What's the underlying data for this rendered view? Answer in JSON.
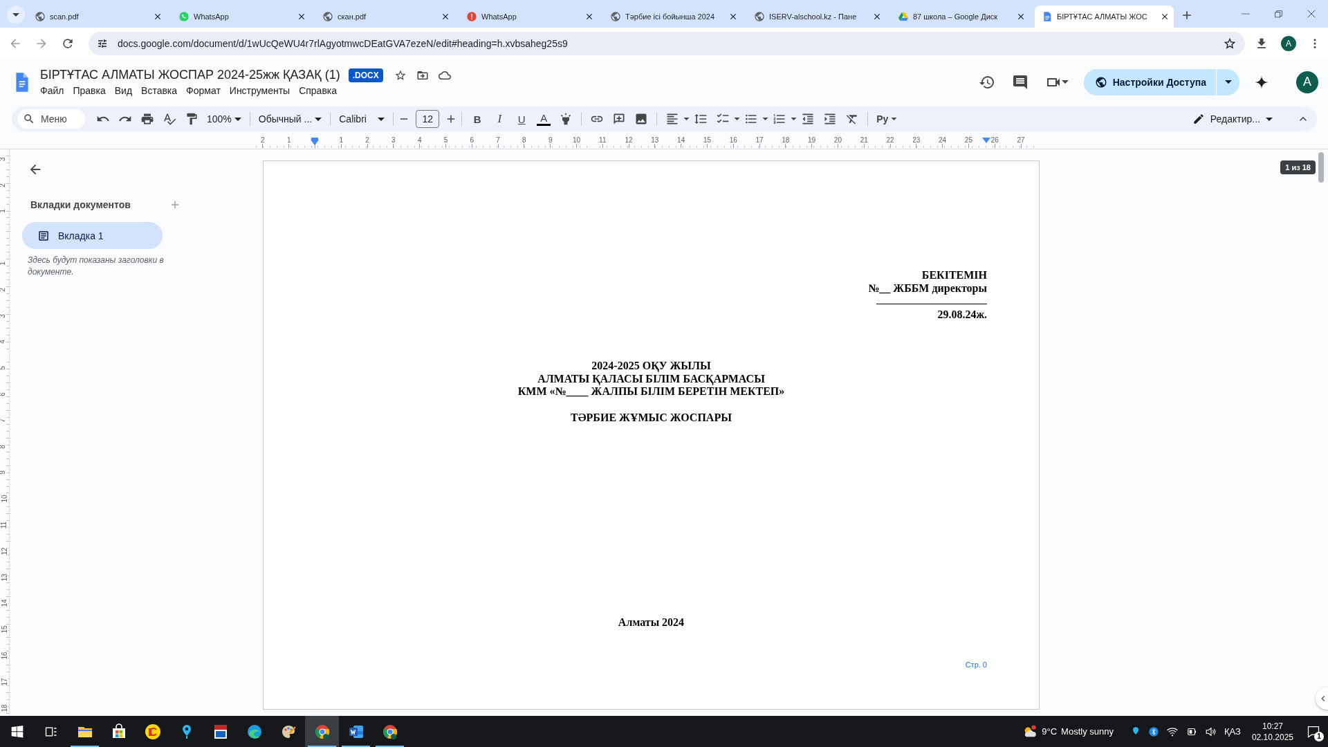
{
  "browser": {
    "tabs": [
      {
        "title": "scan.pdf",
        "kind": "globe",
        "selected": false
      },
      {
        "title": "WhatsApp",
        "kind": "whatsapp",
        "selected": false
      },
      {
        "title": "скан.pdf",
        "kind": "globe",
        "selected": false
      },
      {
        "title": "WhatsApp",
        "kind": "alert",
        "selected": false
      },
      {
        "title": "Тәрбие ісі бойынша 2024",
        "kind": "globe",
        "selected": false
      },
      {
        "title": "ISERV-alschool.kz - Пане",
        "kind": "globe",
        "selected": false
      },
      {
        "title": "87 школа – Google Диск",
        "kind": "drive",
        "selected": false
      },
      {
        "title": "БІРТҰТАС АЛМАТЫ ЖОС",
        "kind": "docs",
        "selected": true
      }
    ],
    "url": "docs.google.com/document/d/1wUcQeWU4r7rlAgyotmwcDEatGVA7ezeN/edit#heading=h.xvbsaheg25s9",
    "profile": "A"
  },
  "document": {
    "title": "БІРТҰТАС АЛМАТЫ ЖОСПАР 2024-25жж ҚАЗАҚ (1)",
    "badge": ".DOCX",
    "menu": [
      "Файл",
      "Правка",
      "Вид",
      "Вставка",
      "Формат",
      "Инструменты",
      "Справка"
    ],
    "share_button": "Настройки Доступа",
    "account": "A"
  },
  "toolbar": {
    "search": "Меню",
    "zoom": "100%",
    "style": "Обычный ...",
    "font": "Calibri",
    "font_size": "12",
    "bold": "B",
    "italic": "I",
    "underline": "U",
    "text_color": "A",
    "input_tools": "Ру",
    "mode": "Редактир..."
  },
  "ruler": {
    "left_margin_labels": [
      "2",
      "1"
    ],
    "labels": [
      "1",
      "2",
      "3",
      "4",
      "5",
      "6",
      "7",
      "8",
      "9",
      "10",
      "11",
      "12",
      "13",
      "14",
      "15",
      "16",
      "17",
      "18",
      "19",
      "20",
      "21",
      "22",
      "23",
      "24",
      "25",
      "26",
      "27"
    ],
    "top_margin_labels": [
      "3",
      "2",
      "1"
    ],
    "vertical_labels": [
      "1",
      "2",
      "3",
      "4",
      "5",
      "6",
      "7",
      "8",
      "9",
      "10",
      "11",
      "12",
      "13",
      "14",
      "15",
      "16",
      "17",
      "18"
    ]
  },
  "sidebar": {
    "heading": "Вкладки документов",
    "tabs": [
      {
        "label": "Вкладка 1",
        "selected": true
      }
    ],
    "hint": "Здесь будут показаны заголовки в документе."
  },
  "page": {
    "approval": [
      {
        "kind": "text",
        "text": "БЕКІТЕМІН"
      },
      {
        "kind": "text",
        "text": "№__ ЖББМ директоры"
      },
      {
        "kind": "signature-line"
      },
      {
        "kind": "text",
        "text": "29.08.24ж."
      }
    ],
    "heading": [
      "2024-2025 ОҚУ ЖЫЛЫ",
      "АЛМАТЫ ҚАЛАСЫ БІЛІМ БАСҚАРМАСЫ",
      "КММ «№____ ЖАЛПЫ БІЛІМ БЕРЕТІН МЕКТЕП»"
    ],
    "plan_title": "ТӘРБИЕ ЖҰМЫС ЖОСПАРЫ",
    "city_year": "Алматы 2024",
    "page_label": "Стр. 0"
  },
  "page_counter": "1 из 18",
  "taskbar": {
    "apps": [
      {
        "kind": "start",
        "running": false,
        "selected": false
      },
      {
        "kind": "task-view",
        "running": false,
        "selected": false
      },
      {
        "kind": "explorer",
        "running": true,
        "selected": false
      },
      {
        "kind": "store",
        "running": false,
        "selected": false
      },
      {
        "kind": "accounting",
        "running": false,
        "selected": false
      },
      {
        "kind": "pin",
        "running": false,
        "selected": false
      },
      {
        "kind": "pdf",
        "running": false,
        "selected": false
      },
      {
        "kind": "edge",
        "running": false,
        "selected": false
      },
      {
        "kind": "paint",
        "running": false,
        "selected": false
      },
      {
        "kind": "chrome",
        "running": true,
        "selected": true
      },
      {
        "kind": "word",
        "running": true,
        "selected": false
      },
      {
        "kind": "chrome",
        "running": true,
        "selected": false
      }
    ],
    "weather": {
      "temperature": "9°C",
      "condition": "Mostly sunny"
    },
    "language": "ҚАЗ",
    "time": "10:27",
    "date": "02.10.2025",
    "notifications": "1"
  }
}
